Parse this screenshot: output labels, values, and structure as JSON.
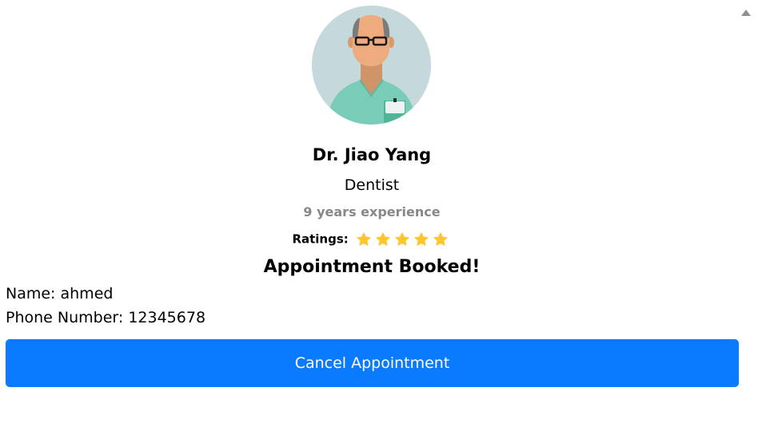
{
  "doctor": {
    "name": "Dr. Jiao Yang",
    "specialty": "Dentist",
    "experience": "9 years experience",
    "ratings_label": "Ratings:",
    "rating": 5,
    "rating_max": 5
  },
  "appointment": {
    "status": "Appointment Booked!",
    "name_line": "Name: ahmed",
    "phone_line": "Phone Number: 12345678",
    "cancel_label": "Cancel Appointment"
  },
  "colors": {
    "button": "#0a7bff",
    "star": "#ffc531",
    "experience_text": "#888888"
  },
  "icons": {
    "avatar": "doctor-avatar",
    "star": "star-icon",
    "scroll": "scroll-up-arrow-icon"
  }
}
